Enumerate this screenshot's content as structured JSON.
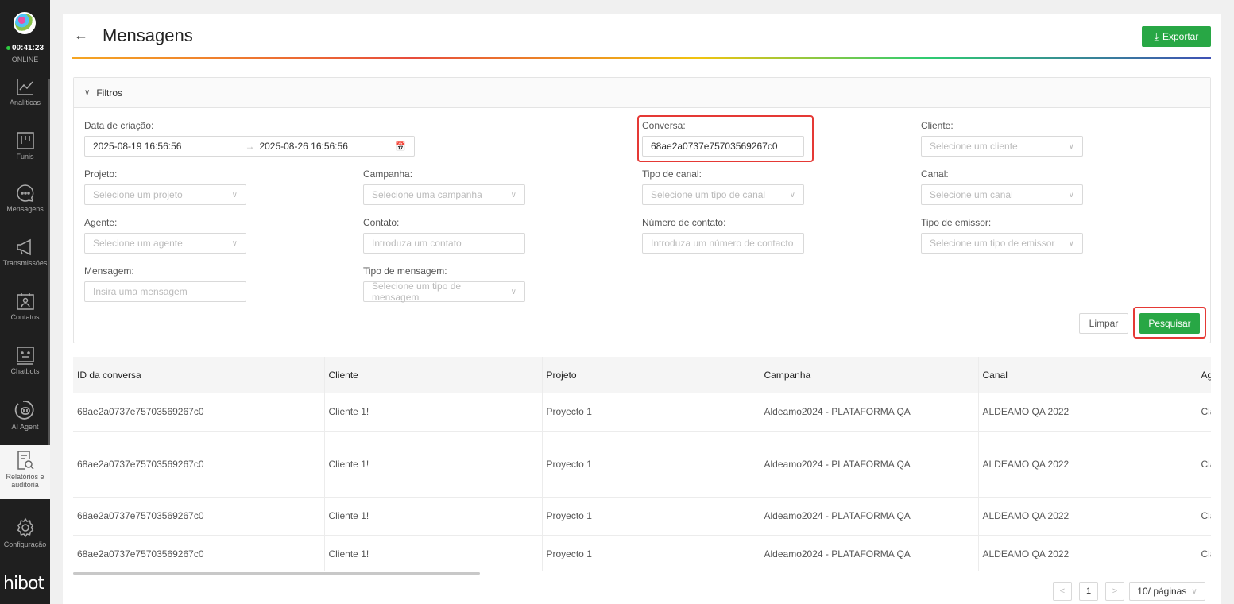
{
  "sidebar": {
    "time": "00:41:23",
    "status": "ONLINE",
    "items": [
      {
        "label": "Analíticas",
        "icon": "chart-line-icon"
      },
      {
        "label": "Funis",
        "icon": "kanban-icon"
      },
      {
        "label": "Mensagens",
        "icon": "chat-bubble-icon"
      },
      {
        "label": "Transmissões",
        "icon": "megaphone-icon"
      },
      {
        "label": "Contatos",
        "icon": "contacts-icon"
      },
      {
        "label": "Chatbots",
        "icon": "robot-icon"
      },
      {
        "label": "AI Agent",
        "icon": "ai-agent-icon"
      },
      {
        "label": "Relatórios e auditoria",
        "icon": "report-search-icon"
      },
      {
        "label": "Configuração",
        "icon": "gear-icon"
      }
    ],
    "logo": "hibot"
  },
  "header": {
    "title": "Mensagens",
    "export_label": "Exportar"
  },
  "filters": {
    "title": "Filtros",
    "date": {
      "label": "Data de criação",
      "start": "2025-08-19 16:56:56",
      "end": "2025-08-26 16:56:56"
    },
    "conversa": {
      "label": "Conversa",
      "value": "68ae2a0737e75703569267c0"
    },
    "cliente": {
      "label": "Cliente",
      "placeholder": "Selecione um cliente"
    },
    "projeto": {
      "label": "Projeto",
      "placeholder": "Selecione um projeto"
    },
    "campanha": {
      "label": "Campanha",
      "placeholder": "Selecione uma campanha"
    },
    "tipo_canal": {
      "label": "Tipo de canal",
      "placeholder": "Selecione um tipo de canal"
    },
    "canal": {
      "label": "Canal",
      "placeholder": "Selecione um canal"
    },
    "agente": {
      "label": "Agente",
      "placeholder": "Selecione um agente"
    },
    "contato": {
      "label": "Contato",
      "placeholder": "Introduza um contato"
    },
    "numero_contato": {
      "label": "Número de contato",
      "placeholder": "Introduza um número de contacto"
    },
    "tipo_emissor": {
      "label": "Tipo de emissor",
      "placeholder": "Selecione um tipo de emissor"
    },
    "mensagem": {
      "label": "Mensagem",
      "placeholder": "Insira uma mensagem"
    },
    "tipo_mensagem": {
      "label": "Tipo de mensagem",
      "placeholder": "Selecione um tipo de mensagem"
    },
    "clear_label": "Limpar",
    "search_label": "Pesquisar"
  },
  "table": {
    "columns": [
      "ID da conversa",
      "Cliente",
      "Projeto",
      "Campanha",
      "Canal",
      "Ag"
    ],
    "rows": [
      [
        "68ae2a0737e75703569267c0",
        "Cliente 1!",
        "Proyecto 1",
        "Aldeamo2024 - PLATAFORMA QA",
        "ALDEAMO QA 2022",
        "Cla"
      ],
      [
        "68ae2a0737e75703569267c0",
        "Cliente 1!",
        "Proyecto 1",
        "Aldeamo2024 - PLATAFORMA QA",
        "ALDEAMO QA 2022",
        "Cla"
      ],
      [
        "68ae2a0737e75703569267c0",
        "Cliente 1!",
        "Proyecto 1",
        "Aldeamo2024 - PLATAFORMA QA",
        "ALDEAMO QA 2022",
        "Cla"
      ],
      [
        "68ae2a0737e75703569267c0",
        "Cliente 1!",
        "Proyecto 1",
        "Aldeamo2024 - PLATAFORMA QA",
        "ALDEAMO QA 2022",
        "Cla"
      ]
    ]
  },
  "pagination": {
    "current_page": "1",
    "page_size": "10/ páginas"
  },
  "colors": {
    "accent": "#28a745",
    "sidebar_bg": "#1f1f1f",
    "highlight": "#e53935"
  }
}
